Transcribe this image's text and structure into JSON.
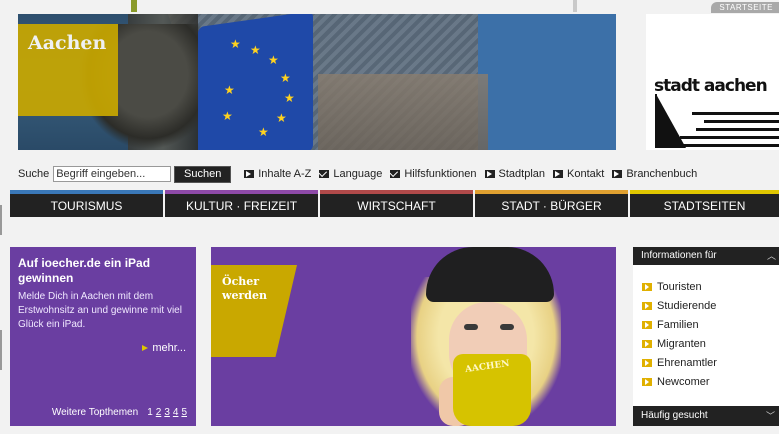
{
  "top": {
    "startseite_label": "STARTSEITE"
  },
  "header": {
    "city_label": "Aachen",
    "logo_text": "stadt aachen"
  },
  "search": {
    "label": "Suche",
    "placeholder": "Begriff eingeben...",
    "value": "Begriff eingeben...",
    "button_label": "Suchen"
  },
  "quicklinks": [
    {
      "label": "Inhalte A-Z",
      "icon": "arrow-icon"
    },
    {
      "label": "Language",
      "icon": "mail-icon"
    },
    {
      "label": "Hilfsfunktionen",
      "icon": "mail-icon"
    },
    {
      "label": "Stadtplan",
      "icon": "arrow-icon"
    },
    {
      "label": "Kontakt",
      "icon": "arrow-icon"
    },
    {
      "label": "Branchenbuch",
      "icon": "arrow-icon"
    }
  ],
  "nav": [
    {
      "label": "TOURISMUS",
      "color": "#3a78b8"
    },
    {
      "label": "KULTUR · FREIZEIT",
      "color": "#8e4aa8"
    },
    {
      "label": "WIRTSCHAFT",
      "color": "#b14a4a"
    },
    {
      "label": "STADT · BÜRGER",
      "color": "#e0a030"
    },
    {
      "label": "STADTSEITEN",
      "color": "#e0c600"
    }
  ],
  "promo": {
    "title": "Auf ioecher.de ein iPad gewinnen",
    "text": "Melde Dich in Aachen mit dem Erstwohnsitz an und gewinne mit viel Glück ein iPad.",
    "more_label": "mehr...",
    "pager_label": "Weitere Topthemen",
    "pages": [
      "1",
      "2",
      "3",
      "4",
      "5"
    ]
  },
  "teaser": {
    "ribbon_line1": "Öcher",
    "ribbon_line2": "werden",
    "cup_text": "AACHEN"
  },
  "sidebar": {
    "header": "Informationen für",
    "items": [
      "Touristen",
      "Studierende",
      "Familien",
      "Migranten",
      "Ehrenamtler",
      "Newcomer"
    ],
    "header2": "Häufig gesucht"
  },
  "colors": {
    "purple": "#6a3ea1",
    "gold": "#c9a800",
    "bullet": "#e0b000",
    "nav_bg": "#222222"
  }
}
